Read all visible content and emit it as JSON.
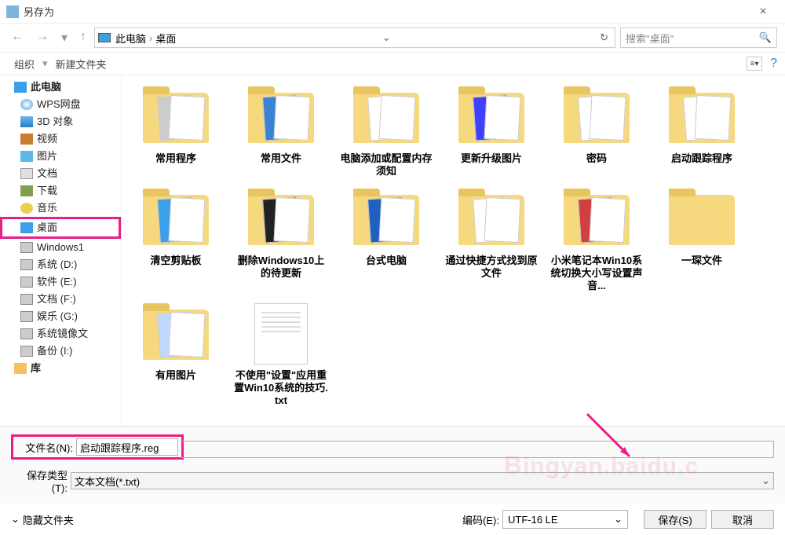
{
  "title": "另存为",
  "breadcrumb": {
    "root": "此电脑",
    "current": "桌面"
  },
  "search_placeholder": "搜索\"桌面\"",
  "toolbar": {
    "organize": "组织",
    "new_folder": "新建文件夹"
  },
  "sidebar": [
    {
      "label": "此电脑",
      "icon": "ic-pc",
      "level": 1
    },
    {
      "label": "WPS网盘",
      "icon": "ic-cloud",
      "level": 2
    },
    {
      "label": "3D 对象",
      "icon": "ic-3d",
      "level": 2
    },
    {
      "label": "视频",
      "icon": "ic-video",
      "level": 2
    },
    {
      "label": "图片",
      "icon": "ic-img",
      "level": 2
    },
    {
      "label": "文档",
      "icon": "ic-doc",
      "level": 2
    },
    {
      "label": "下载",
      "icon": "ic-dl",
      "level": 2
    },
    {
      "label": "音乐",
      "icon": "ic-music",
      "level": 2
    },
    {
      "label": "桌面",
      "icon": "ic-desk",
      "level": 2,
      "selected": true
    },
    {
      "label": "Windows1",
      "icon": "ic-drive",
      "level": 2
    },
    {
      "label": "系统 (D:)",
      "icon": "ic-drive",
      "level": 2
    },
    {
      "label": "软件 (E:)",
      "icon": "ic-drive",
      "level": 2
    },
    {
      "label": "文档 (F:)",
      "icon": "ic-drive",
      "level": 2
    },
    {
      "label": "娱乐 (G:)",
      "icon": "ic-drive",
      "level": 2
    },
    {
      "label": "系统镜像文",
      "icon": "ic-drive",
      "level": 2
    },
    {
      "label": "备份 (I:)",
      "icon": "ic-drive",
      "level": 2
    },
    {
      "label": "库",
      "icon": "ic-lib",
      "level": 1
    }
  ],
  "files": [
    {
      "label": "常用程序",
      "type": "folder",
      "preview": "disc"
    },
    {
      "label": "常用文件",
      "type": "folder",
      "preview": "edge"
    },
    {
      "label": "电脑添加或配置内存须知",
      "type": "folder",
      "preview": "doc"
    },
    {
      "label": "更新升级图片",
      "type": "folder",
      "preview": "blue"
    },
    {
      "label": "密码",
      "type": "folder",
      "preview": "doc"
    },
    {
      "label": "启动跟踪程序",
      "type": "folder",
      "preview": "doc"
    },
    {
      "label": "清空剪贴板",
      "type": "folder",
      "preview": "win"
    },
    {
      "label": "删除Windows10上的待更新",
      "type": "folder",
      "preview": "dark"
    },
    {
      "label": "台式电脑",
      "type": "folder",
      "preview": "intel"
    },
    {
      "label": "通过快捷方式找到原文件",
      "type": "folder",
      "preview": "doc"
    },
    {
      "label": "小米笔记本Win10系统切换大小写设置声音...",
      "type": "folder",
      "preview": "red"
    },
    {
      "label": "一琛文件",
      "type": "folder",
      "preview": "none"
    },
    {
      "label": "有用图片",
      "type": "folder",
      "preview": "screens"
    },
    {
      "label": "不使用\"设置\"应用重置Win10系统的技巧.txt",
      "type": "txt"
    }
  ],
  "filename": {
    "label": "文件名(N):",
    "value": "启动跟踪程序.reg"
  },
  "filetype": {
    "label": "保存类型(T):",
    "value": "文本文档(*.txt)"
  },
  "footer": {
    "hide_folders": "隐藏文件夹",
    "encoding_label": "编码(E):",
    "encoding_value": "UTF-16 LE",
    "save": "保存(S)",
    "cancel": "取消"
  },
  "watermark": "ingyan.baidu.c"
}
